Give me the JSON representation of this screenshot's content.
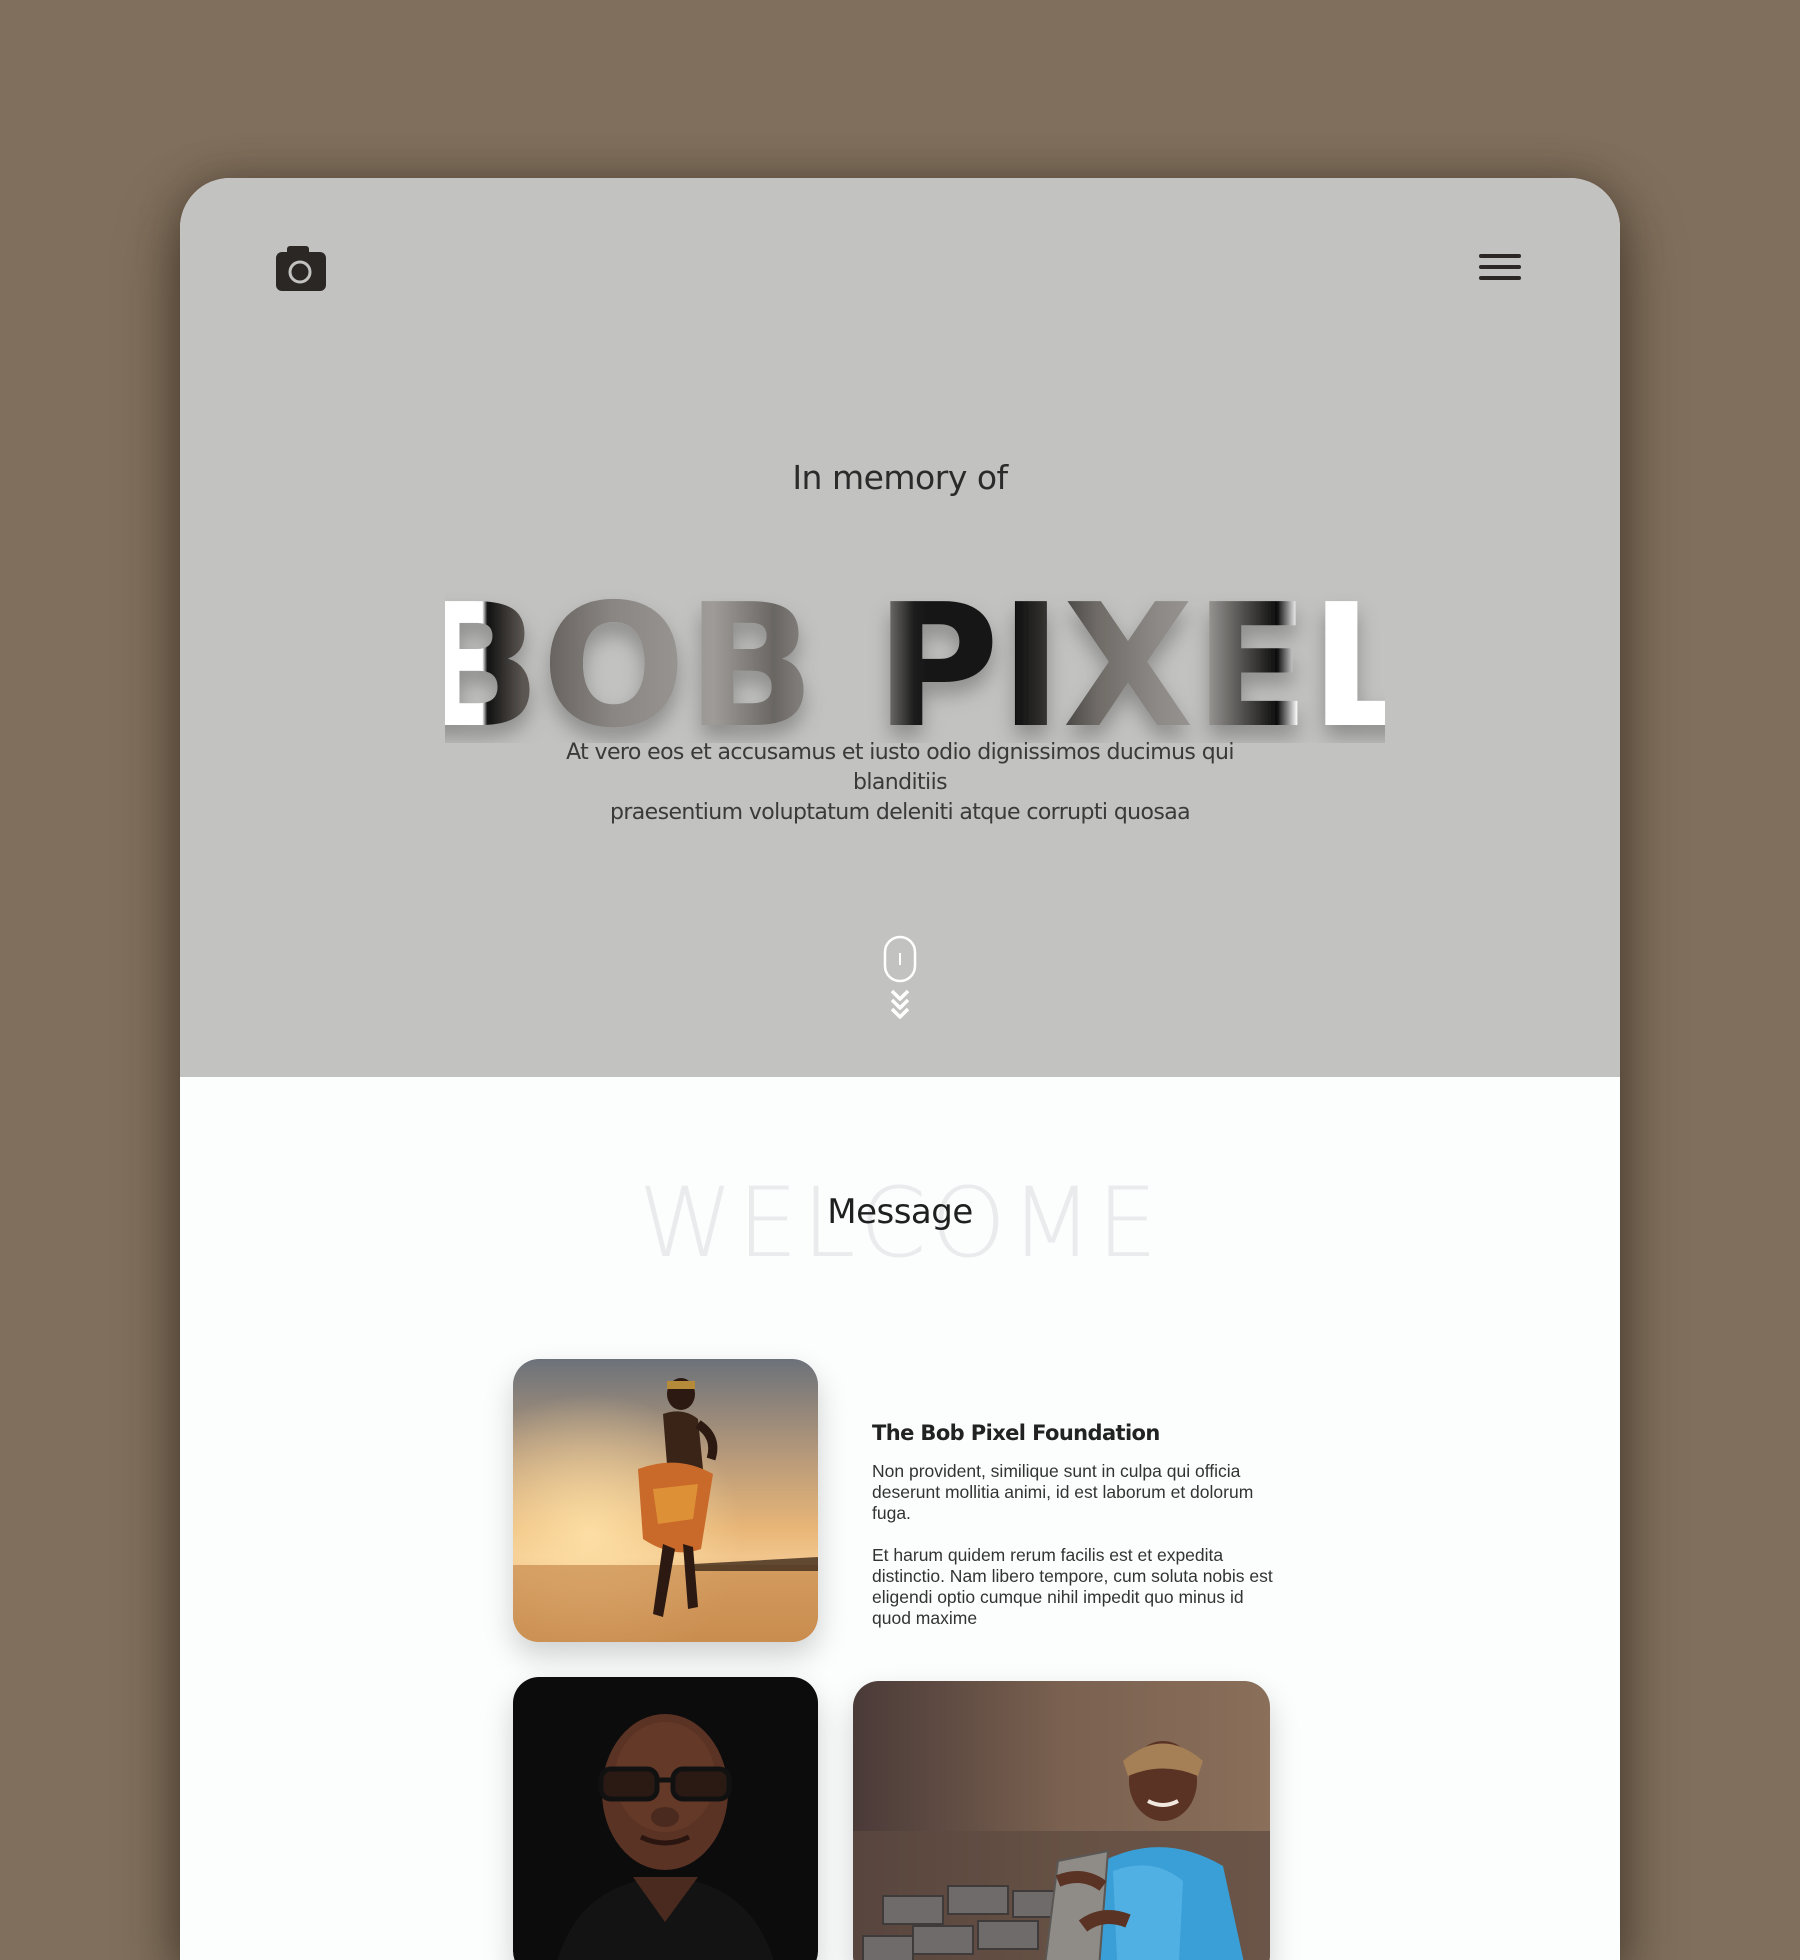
{
  "colors": {
    "background": "#806f5c",
    "hero": "#c2c2c0",
    "page": "#fcfefe",
    "text_dark": "#2b2b2b"
  },
  "header": {
    "logo_icon": "camera-icon",
    "menu_icon": "hamburger-menu-icon"
  },
  "hero": {
    "pretitle": "In memory of",
    "name": "BOB PIXEL",
    "subtitle_line1": "At vero eos et accusamus et iusto odio dignissimos ducimus qui blanditiis",
    "subtitle_line2": "praesentium voluptatum deleniti atque corrupti quosaa",
    "scroll_icon": "mouse-scroll-icon"
  },
  "welcome": {
    "background_word": "WELCOME",
    "title": "Message"
  },
  "foundation": {
    "heading": "The Bob Pixel Foundation",
    "paragraph1": "Non provident, similique sunt in culpa qui officia deserunt mollitia animi, id est laborum et dolorum fuga.",
    "paragraph2": "Et harum quidem rerum facilis est et expedita distinctio. Nam libero tempore, cum soluta nobis est eligendi optio cumque nihil impedit quo minus id quod maxime"
  }
}
